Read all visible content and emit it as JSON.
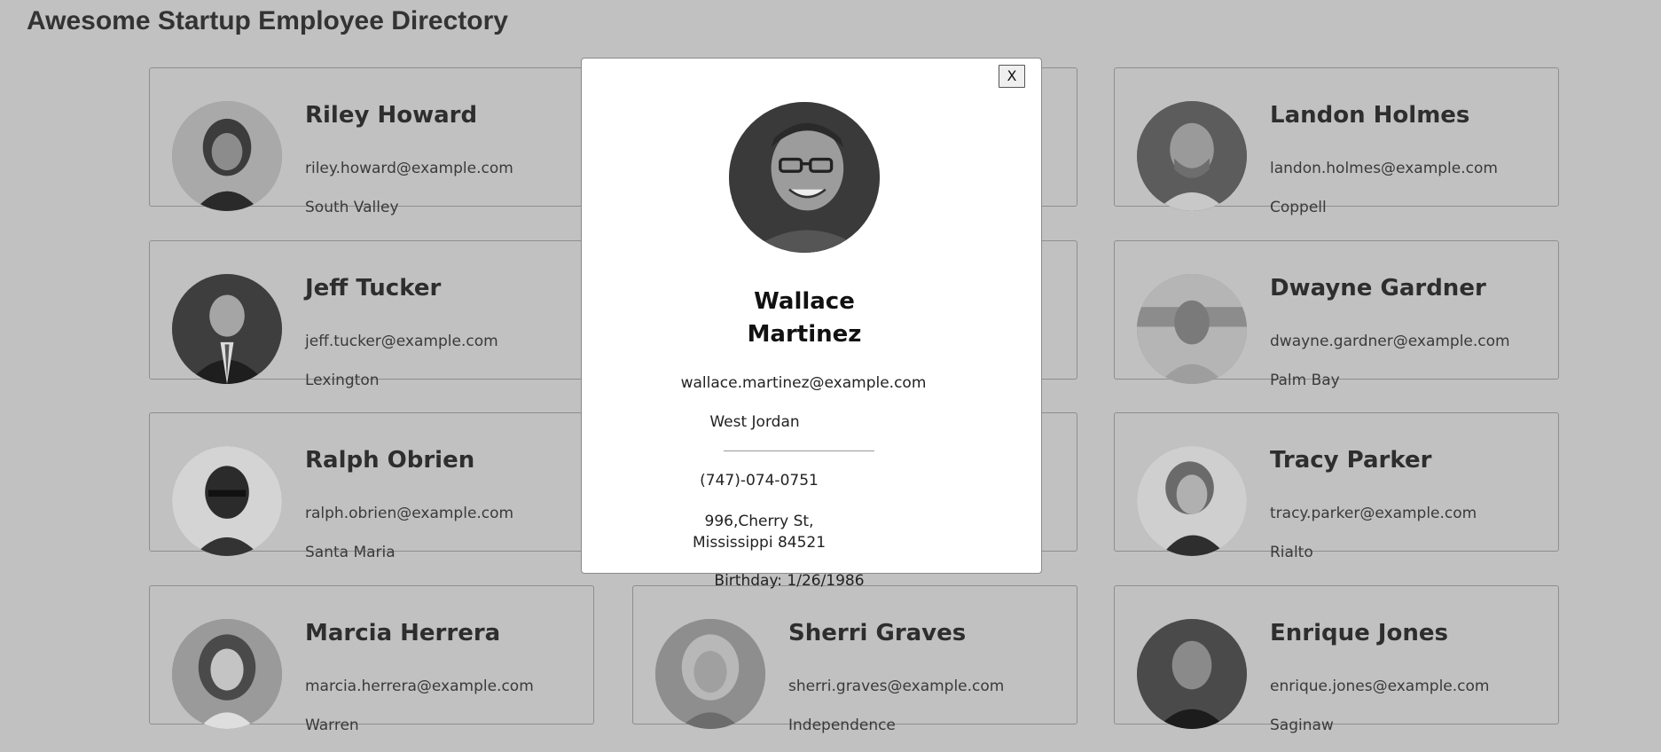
{
  "app": {
    "title": "Awesome Startup Employee Directory"
  },
  "employees": [
    {
      "name": "Riley Howard",
      "email": "riley.howard@example.com",
      "city": "South Valley"
    },
    {
      "name": "Landon Holmes",
      "email": "landon.holmes@example.com",
      "city": "Coppell"
    },
    {
      "name": "Jeff Tucker",
      "email": "jeff.tucker@example.com",
      "city": "Lexington"
    },
    {
      "name": "Dwayne Gardner",
      "email": "dwayne.gardner@example.com",
      "city": "Palm Bay"
    },
    {
      "name": "Ralph Obrien",
      "email": "ralph.obrien@example.com",
      "city": "Santa Maria"
    },
    {
      "name": "Tracy Parker",
      "email": "tracy.parker@example.com",
      "city": "Rialto"
    },
    {
      "name": "Marcia Herrera",
      "email": "marcia.herrera@example.com",
      "city": "Warren"
    },
    {
      "name": "Sherri Graves",
      "email": "sherri.graves@example.com",
      "city": "Independence"
    },
    {
      "name": "Enrique Jones",
      "email": "enrique.jones@example.com",
      "city": "Saginaw"
    }
  ],
  "modal": {
    "close_label": "X",
    "name_first": "Wallace",
    "name_last": "Martinez",
    "email": "wallace.martinez@example.com",
    "city": "West Jordan",
    "phone": "(747)-074-0751",
    "address_line1": "996,Cherry St,",
    "address_line2": "Mississippi 84521",
    "birthday": "Birthday: 1/26/1986"
  },
  "colors": {
    "overlay_background": "#c1c1c1",
    "modal_background": "#ffffff"
  }
}
